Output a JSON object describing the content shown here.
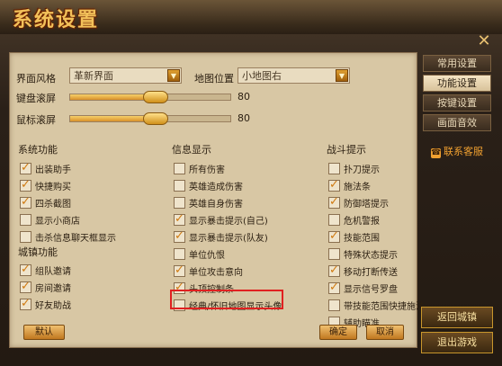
{
  "window": {
    "title": "系统设置"
  },
  "general": {
    "ui_style_label": "界面风格",
    "ui_style_value": "革新界面",
    "map_pos_label": "地图位置",
    "map_pos_value": "小地图右",
    "keyboard_scroll_label": "键盘滚屏",
    "keyboard_scroll_value": "80",
    "keyboard_scroll_level": 0.8,
    "mouse_scroll_label": "鼠标滚屏",
    "mouse_scroll_value": "80",
    "mouse_scroll_level": 0.8
  },
  "sections": {
    "system": {
      "title": "系统功能",
      "items": [
        {
          "label": "出装助手",
          "checked": true
        },
        {
          "label": "快捷购买",
          "checked": true
        },
        {
          "label": "四杀截图",
          "checked": true
        },
        {
          "label": "显示小商店",
          "checked": false
        },
        {
          "label": "击杀信息聊天框显示",
          "checked": false
        }
      ]
    },
    "town": {
      "title": "城镇功能",
      "items": [
        {
          "label": "组队邀请",
          "checked": true
        },
        {
          "label": "房间邀请",
          "checked": true
        },
        {
          "label": "好友助战",
          "checked": true
        }
      ]
    },
    "info": {
      "title": "信息显示",
      "items": [
        {
          "label": "所有伤害",
          "checked": false
        },
        {
          "label": "英雄造成伤害",
          "checked": false
        },
        {
          "label": "英雄自身伤害",
          "checked": false
        },
        {
          "label": "显示暴击提示(自己)",
          "checked": true
        },
        {
          "label": "显示暴击提示(队友)",
          "checked": true
        },
        {
          "label": "单位仇恨",
          "checked": false
        },
        {
          "label": "单位攻击意向",
          "checked": true
        },
        {
          "label": "头顶控制条",
          "checked": true
        },
        {
          "label": "经典/怀旧地图显示头像",
          "checked": false
        }
      ]
    },
    "battle": {
      "title": "战斗提示",
      "items": [
        {
          "label": "扑刀提示",
          "checked": false
        },
        {
          "label": "施法条",
          "checked": true
        },
        {
          "label": "防御塔提示",
          "checked": true
        },
        {
          "label": "危机警报",
          "checked": false
        },
        {
          "label": "技能范围",
          "checked": true
        },
        {
          "label": "特殊状态提示",
          "checked": false
        },
        {
          "label": "移动打断传送",
          "checked": true
        },
        {
          "label": "显示信号罗盘",
          "checked": true
        },
        {
          "label": "带技能范围快捷施法",
          "checked": false
        },
        {
          "label": "辅助瞄准",
          "checked": false
        }
      ]
    }
  },
  "buttons": {
    "default": "默认",
    "confirm": "确定",
    "cancel": "取消"
  },
  "side_tabs": [
    {
      "label": "常用设置",
      "active": false
    },
    {
      "label": "功能设置",
      "active": true
    },
    {
      "label": "按键设置",
      "active": false
    },
    {
      "label": "画面音效",
      "active": false
    }
  ],
  "contact": {
    "label": "联系客服",
    "icon": "phone-icon"
  },
  "side_buttons": {
    "return_town": "返回城镇",
    "exit_game": "退出游戏"
  },
  "colors": {
    "accent": "#d07a10",
    "highlight_box": "#e02020",
    "panel_bg": "#d8c7a4"
  }
}
